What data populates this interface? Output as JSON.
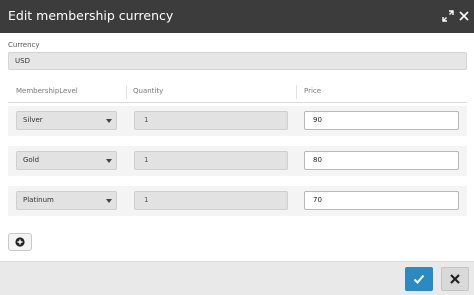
{
  "dialog": {
    "title": "Edit membership currency"
  },
  "currency": {
    "label": "Currency",
    "value": "USD"
  },
  "table": {
    "headers": [
      "MembershipLevel",
      "Quantity",
      "Price"
    ],
    "rows": [
      {
        "level": "Silver",
        "quantity": "1",
        "price": "90"
      },
      {
        "level": "Gold",
        "quantity": "1",
        "price": "80"
      },
      {
        "level": "Platinum",
        "quantity": "1",
        "price": "70"
      }
    ]
  },
  "icons": {
    "expand": "expand-icon",
    "close": "close-icon",
    "dropdown": "chevron-down-icon",
    "add": "plus-circle-icon",
    "confirm": "checkmark-icon",
    "cancel": "x-icon"
  },
  "colors": {
    "titlebar": "#3c3c3c",
    "confirm_button": "#2a8ac4",
    "footer": "#e9e9e9"
  }
}
